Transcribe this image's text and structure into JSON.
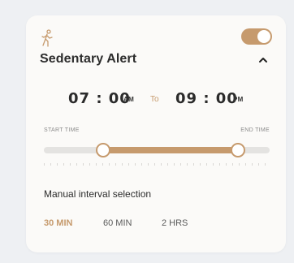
{
  "card": {
    "title": "Sedentary Alert",
    "icon": "walking-person-icon",
    "toggle_on": true,
    "collapse_icon": "chevron-up-icon"
  },
  "time_range": {
    "start_time": "07 : 00",
    "start_period": "AM",
    "separator": "To",
    "end_time": "09 : 00",
    "end_period": "PM",
    "start_label": "START TIME",
    "end_label": "END TIME",
    "slider_start_fraction": 0.256,
    "slider_end_fraction": 0.853
  },
  "interval": {
    "title": "Manual interval selection",
    "options": [
      "30 MIN",
      "60 MIN",
      "2 HRS"
    ],
    "selected": "30 MIN"
  },
  "colors": {
    "accent": "#c69a6d",
    "track": "#e4e3e1",
    "card_bg": "#fbfaf8",
    "page_bg": "#eef0f3",
    "text": "#2b2b2b"
  }
}
